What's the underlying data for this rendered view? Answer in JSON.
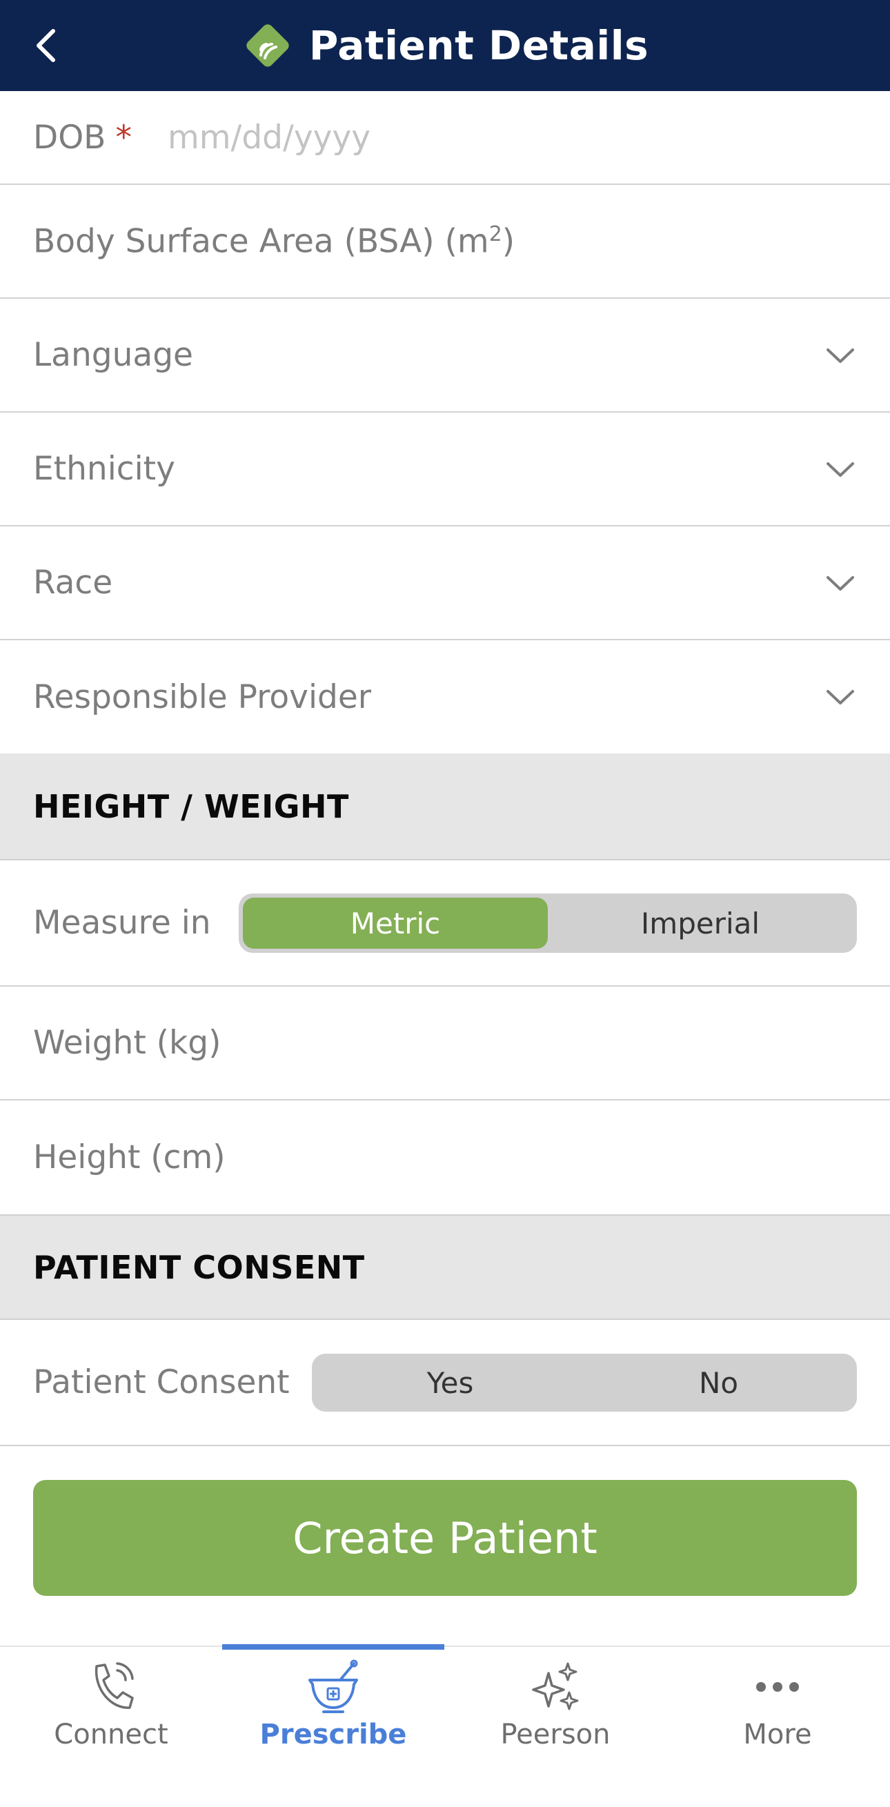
{
  "header": {
    "title": "Patient Details"
  },
  "fields": {
    "dob_label": "DOB",
    "dob_required": "*",
    "dob_placeholder": "mm/dd/yyyy",
    "bsa_label": "Body Surface Area (BSA) (m",
    "bsa_sup": "2",
    "bsa_close": ")",
    "language_label": "Language",
    "ethnicity_label": "Ethnicity",
    "race_label": "Race",
    "provider_label": "Responsible Provider"
  },
  "height_weight": {
    "section_title": "HEIGHT / WEIGHT",
    "measure_label": "Measure in",
    "options": [
      "Metric",
      "Imperial"
    ],
    "selected": "Metric",
    "weight_label": "Weight (kg)",
    "height_label": "Height (cm)"
  },
  "consent": {
    "section_title": "PATIENT CONSENT",
    "label": "Patient Consent",
    "options": [
      "Yes",
      "No"
    ]
  },
  "create_button": "Create Patient",
  "tabbar": {
    "tabs": [
      {
        "label": "Connect",
        "icon": "phone-icon"
      },
      {
        "label": "Prescribe",
        "icon": "mortar-pestle-icon"
      },
      {
        "label": "Peerson",
        "icon": "sparkles-icon"
      },
      {
        "label": "More",
        "icon": "more-dots-icon"
      }
    ],
    "active": "Prescribe"
  },
  "colors": {
    "header_bg": "#0e2450",
    "accent_green": "#83af55",
    "active_blue": "#4a7fd8",
    "section_bg": "#e6e6e6",
    "required_red": "#c0392b"
  }
}
